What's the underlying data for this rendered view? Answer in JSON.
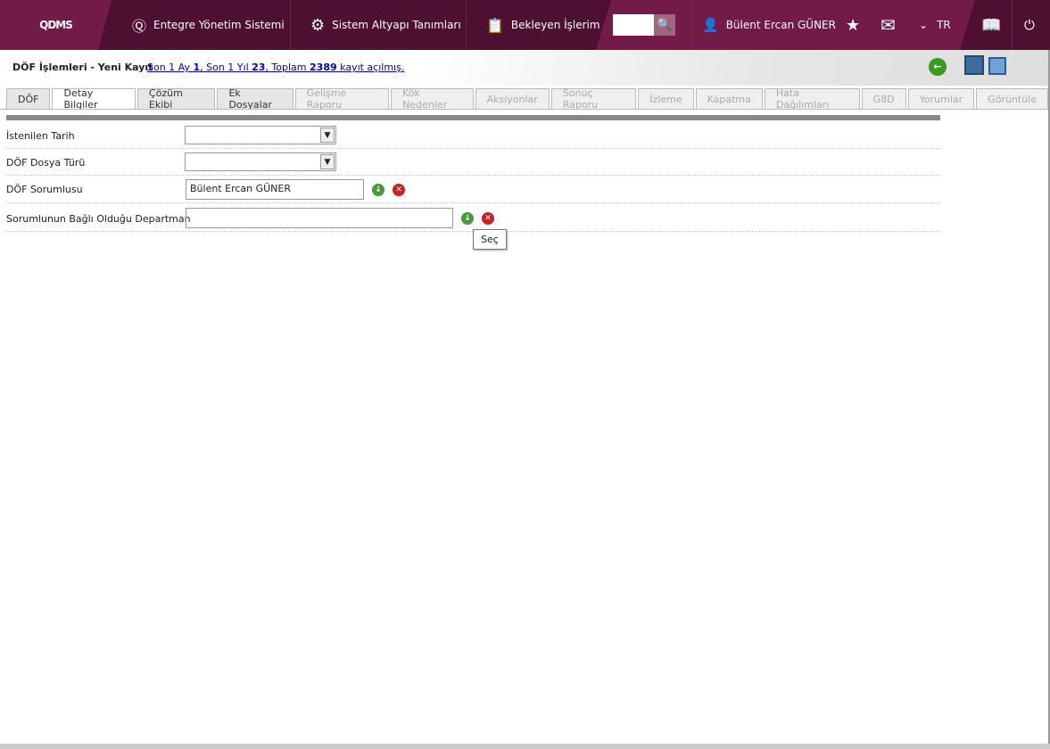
{
  "header": {
    "logo": "QDMS",
    "nav": [
      "Entegre Yönetim Sistemi",
      "Sistem Altyapı Tanımları",
      "Bekleyen İşlerim"
    ],
    "search_value": "",
    "user": "Bülent Ercan GÜNER",
    "language": "TR"
  },
  "page": {
    "title": "DÖF İşlemleri - Yeni Kayıt",
    "stats": {
      "p1": "Son 1 Ay ",
      "v1": "1",
      "p2": ", Son 1 Yıl ",
      "v2": "23",
      "p3": ", Toplam ",
      "v3": "2389",
      "p4": " kayıt açılmış."
    }
  },
  "tabs": [
    {
      "label": "DÖF"
    },
    {
      "label": "Detay Bilgiler",
      "active": true
    },
    {
      "label": "Çözüm Ekibi"
    },
    {
      "label": "Ek Dosyalar"
    },
    {
      "label": "Gelişme Raporu",
      "disabled": true
    },
    {
      "label": "Kök Nedenler",
      "disabled": true
    },
    {
      "label": "Aksiyonlar",
      "disabled": true
    },
    {
      "label": "Sonuç Raporu",
      "disabled": true
    },
    {
      "label": "İzleme",
      "disabled": true
    },
    {
      "label": "Kapatma",
      "disabled": true
    },
    {
      "label": "Hata Dağılımları",
      "disabled": true
    },
    {
      "label": "G8D",
      "disabled": true
    },
    {
      "label": "Yorumlar",
      "disabled": true
    },
    {
      "label": "Görüntüle",
      "disabled": true
    }
  ],
  "form": {
    "date_label": "İstenilen Tarih",
    "type_label": "DÖF Dosya Türü",
    "resp_label": "DÖF Sorumlusu",
    "resp_value": "Bülent Ercan GÜNER",
    "dept_label": "Sorumlunun Bağlı Olduğu Departman",
    "dept_value": ""
  },
  "tooltip": "Seç"
}
